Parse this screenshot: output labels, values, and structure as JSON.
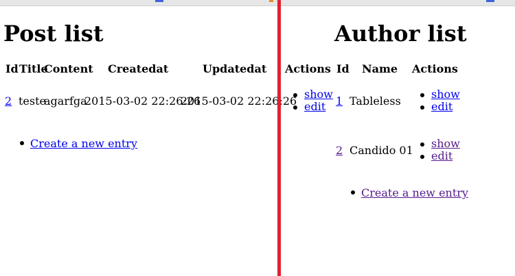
{
  "post_list": {
    "title": "Post list",
    "headers": {
      "id": "Id",
      "title": "Title",
      "content": "Content",
      "createdat": "Createdat",
      "updatedat": "Updatedat",
      "actions": "Actions"
    },
    "rows": [
      {
        "id": "2",
        "title": "teste",
        "content": "agarfga",
        "createdat": "2015-03-02 22:26:26",
        "updatedat": "2015-03-02 22:26:26",
        "show": "show",
        "edit": "edit"
      }
    ],
    "create_link": "Create a new entry"
  },
  "author_list": {
    "title": "Author list",
    "headers": {
      "id": "Id",
      "name": "Name",
      "actions": "Actions"
    },
    "rows": [
      {
        "id": "1",
        "name": "Tableless",
        "show": "show",
        "edit": "edit"
      },
      {
        "id": "2",
        "name": "Candido 01",
        "show": "show",
        "edit": "edit"
      }
    ],
    "create_link": "Create a new entry"
  },
  "colors": {
    "link": "#0000ee",
    "visited_link": "#551a8b",
    "divider": "#e0222f"
  }
}
